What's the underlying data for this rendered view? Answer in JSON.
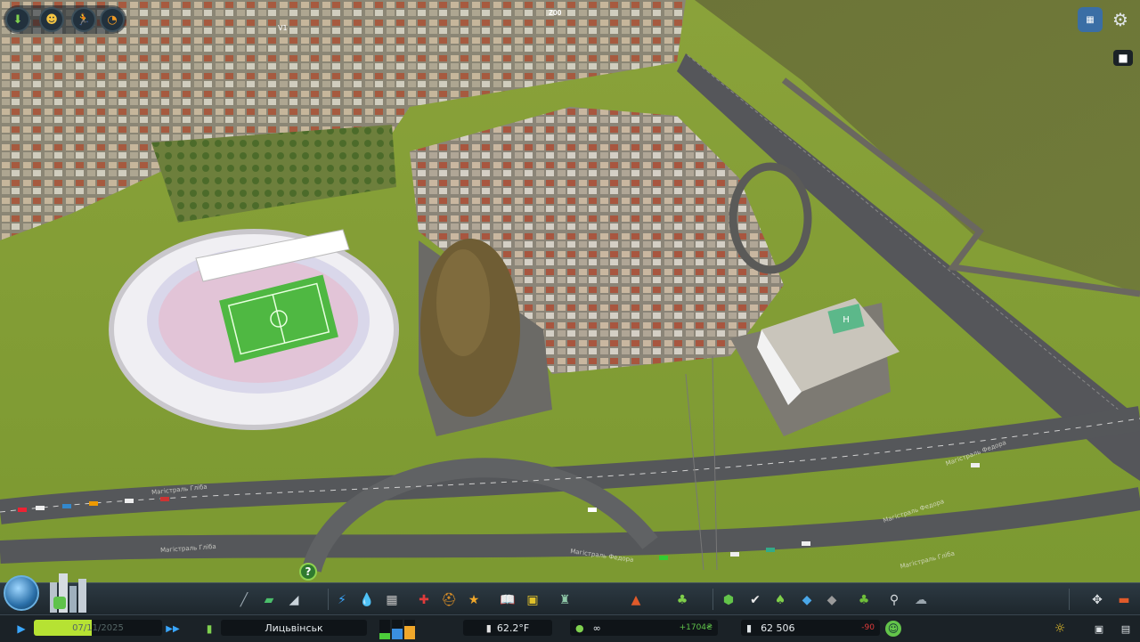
{
  "game": {
    "top_left_buttons": [
      {
        "name": "info-views-icon"
      },
      {
        "name": "citizen-info-icon"
      },
      {
        "name": "pedestrian-icon"
      },
      {
        "name": "time-speed-icon"
      }
    ],
    "top_right_buttons": [
      {
        "name": "chirper-icon"
      },
      {
        "name": "settings-gear-icon"
      },
      {
        "name": "camera-icon"
      }
    ]
  },
  "map": {
    "zoo_sign": "ZOO",
    "signal_label": "V1",
    "road_labels": [
      "Магістраль Гліба",
      "Магістраль Гліба",
      "Магістраль Федора",
      "Магістраль Федора",
      "Магістраль Федора",
      "Магістраль Гліба"
    ]
  },
  "toolbar": {
    "tools": [
      {
        "name": "roads-icon",
        "glyph": "╱",
        "color": "#9aa7b0"
      },
      {
        "name": "zoning-icon",
        "glyph": "▰",
        "color": "#4bbf6b"
      },
      {
        "name": "districts-icon",
        "glyph": "◢",
        "color": "#c9d3da"
      },
      {
        "name": "electricity-icon",
        "glyph": "⚡",
        "color": "#3aa7ff"
      },
      {
        "name": "water-icon",
        "glyph": "💧",
        "color": "#3a9cff"
      },
      {
        "name": "garbage-icon",
        "glyph": "▦",
        "color": "#c2c2c2"
      },
      {
        "name": "healthcare-icon",
        "glyph": "✚",
        "color": "#e03b3b"
      },
      {
        "name": "fire-department-icon",
        "glyph": "⛑",
        "color": "#f09a24"
      },
      {
        "name": "police-icon",
        "glyph": "★",
        "color": "#f0a72a"
      },
      {
        "name": "education-icon",
        "glyph": "📖",
        "color": "#e9e9e9"
      },
      {
        "name": "public-transport-icon",
        "glyph": "▣",
        "color": "#e0c12a"
      },
      {
        "name": "industry-icon",
        "glyph": "♜",
        "color": "#8fc8a8"
      },
      {
        "name": "unique-buildings-icon",
        "glyph": "▲",
        "color": "#e05a2a"
      },
      {
        "name": "parks-icon",
        "glyph": "♣",
        "color": "#7fcf4a"
      },
      {
        "name": "policies-icon",
        "glyph": "⬢",
        "color": "#63c44a"
      },
      {
        "name": "economy-icon",
        "glyph": "✔",
        "color": "#e9e9e9"
      },
      {
        "name": "monuments-icon",
        "glyph": "♠",
        "color": "#7fcf4a"
      },
      {
        "name": "landscaping-icon",
        "glyph": "◆",
        "color": "#4aa7e8"
      },
      {
        "name": "terrain-icon",
        "glyph": "◆",
        "color": "#9a9a9a"
      },
      {
        "name": "trees-icon",
        "glyph": "♣",
        "color": "#6fbf3a"
      },
      {
        "name": "search-icon",
        "glyph": "⚲",
        "color": "#d8dde0"
      },
      {
        "name": "weather-icon",
        "glyph": "☁",
        "color": "#9aa5ad"
      },
      {
        "name": "move-camera-icon",
        "glyph": "✥",
        "color": "#d8dde0"
      },
      {
        "name": "bulldozer-icon",
        "glyph": "▬",
        "color": "#e05a2a"
      }
    ]
  },
  "status": {
    "date": "07/11/2025",
    "date_progress": 0.45,
    "city_name": "Лицьвінськ",
    "temperature": "62.2°F",
    "money": "∞",
    "income": "+1704₴",
    "population": "62 506",
    "population_change": "-90",
    "happiness": "happy",
    "demand_bars": {
      "residential": 0.3,
      "commercial": 0.55,
      "industrial": 0.7
    }
  },
  "colors": {
    "grass": "#6f8a2a",
    "water": "#6f7a34",
    "road": "#5a5a58",
    "accent_green": "#b6e233",
    "toolbar_bg": "#24313a"
  }
}
